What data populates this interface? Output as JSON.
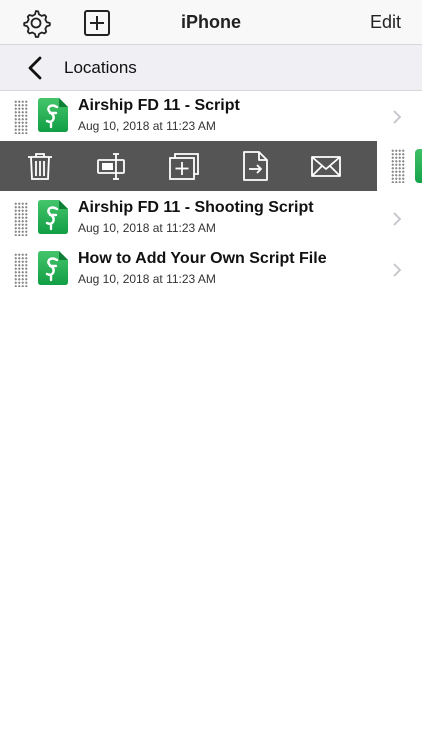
{
  "navbar": {
    "title": "iPhone",
    "edit_label": "Edit",
    "settings_icon": "gear-icon",
    "add_icon": "plus-square-icon"
  },
  "subbar": {
    "back_icon": "chevron-left-icon",
    "label": "Locations"
  },
  "files": [
    {
      "title": "Airship FD 11 - Script",
      "date": "Aug 10, 2018 at 11:23 AM"
    },
    {
      "title": "Airship FD 11 - Shooting Script",
      "date": "Aug 10, 2018 at 11:23 AM"
    },
    {
      "title": "How to Add Your Own Script File",
      "date": "Aug 10, 2018 at 11:23 AM"
    }
  ],
  "actions": [
    "trash-icon",
    "rename-icon",
    "duplicate-icon",
    "export-icon",
    "mail-icon"
  ],
  "colors": {
    "action_bar": "#555555",
    "app_icon_green": "#1fae52",
    "navbar_bg": "#f8f8f8",
    "subbar_bg": "#efeff4"
  }
}
